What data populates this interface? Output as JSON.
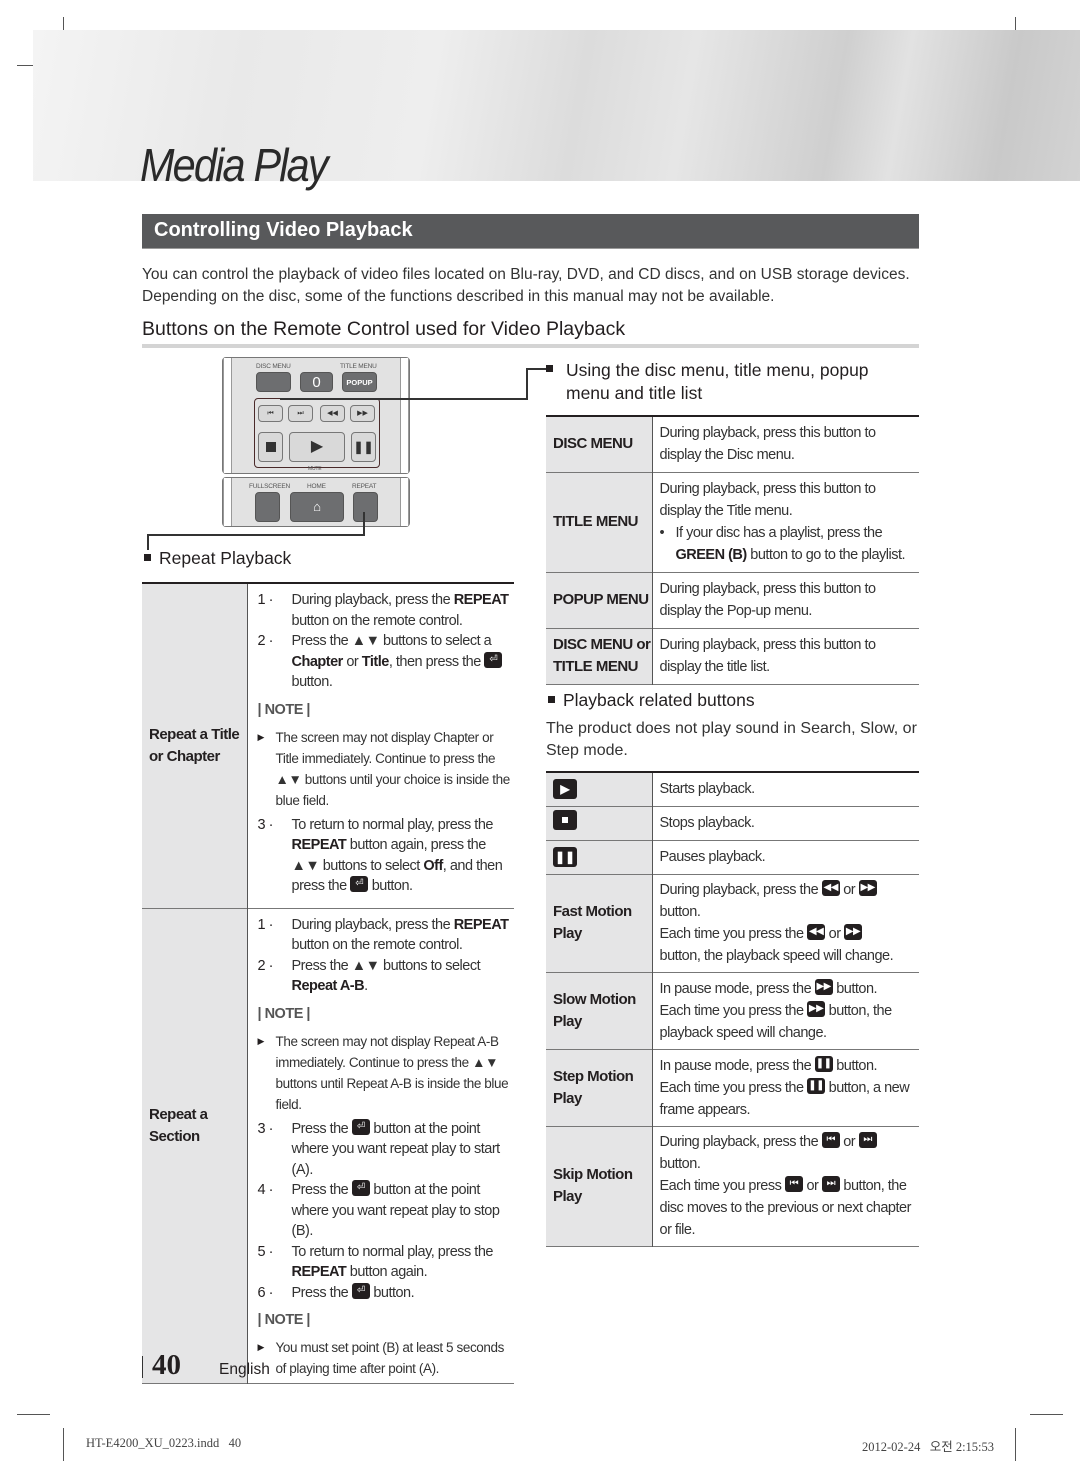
{
  "chapter_title": "Media Play",
  "section_title": "Controlling Video Playback",
  "intro": "You can control the playback of video files located on Blu-ray, DVD, and CD discs, and on USB storage devices. Depending on the disc, some of the functions described in this manual may not be available.",
  "subheading": "Buttons on the Remote Control used for Video Playback",
  "remote": {
    "labels": {
      "disc_menu": "DISC MENU",
      "title_menu": "TITLE MENU",
      "zero": "0",
      "popup": "POPUP",
      "mute": "MUTE",
      "fullscreen": "FULLSCREEN",
      "home": "HOME",
      "repeat": "REPEAT"
    },
    "icons": [
      "skip-back-icon",
      "skip-forward-icon",
      "rewind-icon",
      "fast-forward-icon",
      "stop-icon",
      "play-icon",
      "pause-icon",
      "home-icon"
    ]
  },
  "menu_section": {
    "heading_line1": "Using the disc menu, title menu, popup",
    "heading_line2": "menu and title list",
    "rows": [
      {
        "button": "DISC MENU",
        "desc": "During playback, press this button to display the Disc menu."
      },
      {
        "button": "TITLE MENU",
        "desc": "During playback, press this button to display the Title menu.",
        "bullet_pre": "If your disc has a playlist, press the",
        "bullet_bold": "GREEN (B)",
        "bullet_post": "button to go to the playlist."
      },
      {
        "button": "POPUP MENU",
        "desc": "During playback, press this button to display the Pop-up menu."
      },
      {
        "button_line1": "DISC MENU or",
        "button_line2": "TITLE MENU",
        "desc": "During playback, press this button to display the title list."
      }
    ]
  },
  "playback_section": {
    "heading": "Playback related buttons",
    "note": "The product does not play sound in Search, Slow, or Step mode.",
    "rows": [
      {
        "icon": "play-icon",
        "desc": "Starts playback."
      },
      {
        "icon": "stop-icon",
        "desc": "Stops playback."
      },
      {
        "icon": "pause-icon",
        "desc": "Pauses playback."
      },
      {
        "label_line1": "Fast Motion",
        "label_line2": "Play",
        "l1": "During playback, press the",
        "or": "or",
        "l2": "button.",
        "l3": "Each time you press the",
        "l4": "button, the playback speed will change."
      },
      {
        "label_line1": "Slow Motion",
        "label_line2": "Play",
        "l1": "In pause mode, press the",
        "l2": "button.",
        "l3": "Each time you press the",
        "l4": "button, the playback speed will change."
      },
      {
        "label_line1": "Step Motion",
        "label_line2": "Play",
        "l1": "In pause mode, press the",
        "l2": "button.",
        "l3": "Each time you press the",
        "l4": "button, a new frame appears."
      },
      {
        "label_line1": "Skip Motion",
        "label_line2": "Play",
        "l1": "During playback, press the",
        "or": "or",
        "l2": "button.",
        "l3": "Each time you press",
        "l4": "button, the disc moves to the previous or next chapter or file."
      }
    ]
  },
  "repeat_section": {
    "heading": "Repeat Playback",
    "note_label": "| NOTE |",
    "title_row": {
      "label_line1": "Repeat a Title",
      "label_line2": "or Chapter",
      "s1_num": "1 ·",
      "s1_pre": "During playback, press the",
      "s1_bold": "REPEAT",
      "s1_post": "button on the remote control.",
      "s2_num": "2 ·",
      "s2_pre": "Press the ▲▼ buttons to select a",
      "s2_b1": "Chapter",
      "s2_or": "or",
      "s2_b2": "Title",
      "s2_post": ", then press the",
      "s2_end": "button.",
      "note": "The screen may not display Chapter or Title immediately. Continue to press the ▲▼ buttons until your choice is inside the blue field.",
      "s3_num": "3 ·",
      "s3_pre": "To return to normal play, press the",
      "s3_bold": "REPEAT",
      "s3_mid": "button again, press the ▲▼ buttons to select",
      "s3_b2": "Off",
      "s3_post": ", and then press the",
      "s3_end": "button."
    },
    "section_row": {
      "label_line1": "Repeat a",
      "label_line2": "Section",
      "s1_num": "1 ·",
      "s1_pre": "During playback, press the",
      "s1_bold": "REPEAT",
      "s1_post": "button on the remote control.",
      "s2_num": "2 ·",
      "s2_pre": "Press the ▲▼ buttons to select",
      "s2_bold": "Repeat A-B",
      "s2_post": ".",
      "note1": "The screen may not display Repeat A-B immediately. Continue to press the ▲▼ buttons until  Repeat A-B  is inside the blue field.",
      "s3_num": "3 ·",
      "s3_pre": "Press the",
      "s3_post": "button at the point where you want repeat play to start (A).",
      "s4_num": "4 ·",
      "s4_pre": "Press the",
      "s4_post": "button at the point where you want repeat play to stop (B).",
      "s5_num": "5 ·",
      "s5_pre": "To return to normal play, press the",
      "s5_bold": "REPEAT",
      "s5_post": "button again.",
      "s6_num": "6 ·",
      "s6_pre": "Press the",
      "s6_post": "button.",
      "note2": "You must set point (B) at least 5 seconds of playing time after point (A)."
    }
  },
  "page": {
    "number": "40",
    "language": "English"
  },
  "footer": {
    "file": "HT-E4200_XU_0223.indd   40",
    "timestamp": "2012-02-24   오전 2:15:53"
  }
}
